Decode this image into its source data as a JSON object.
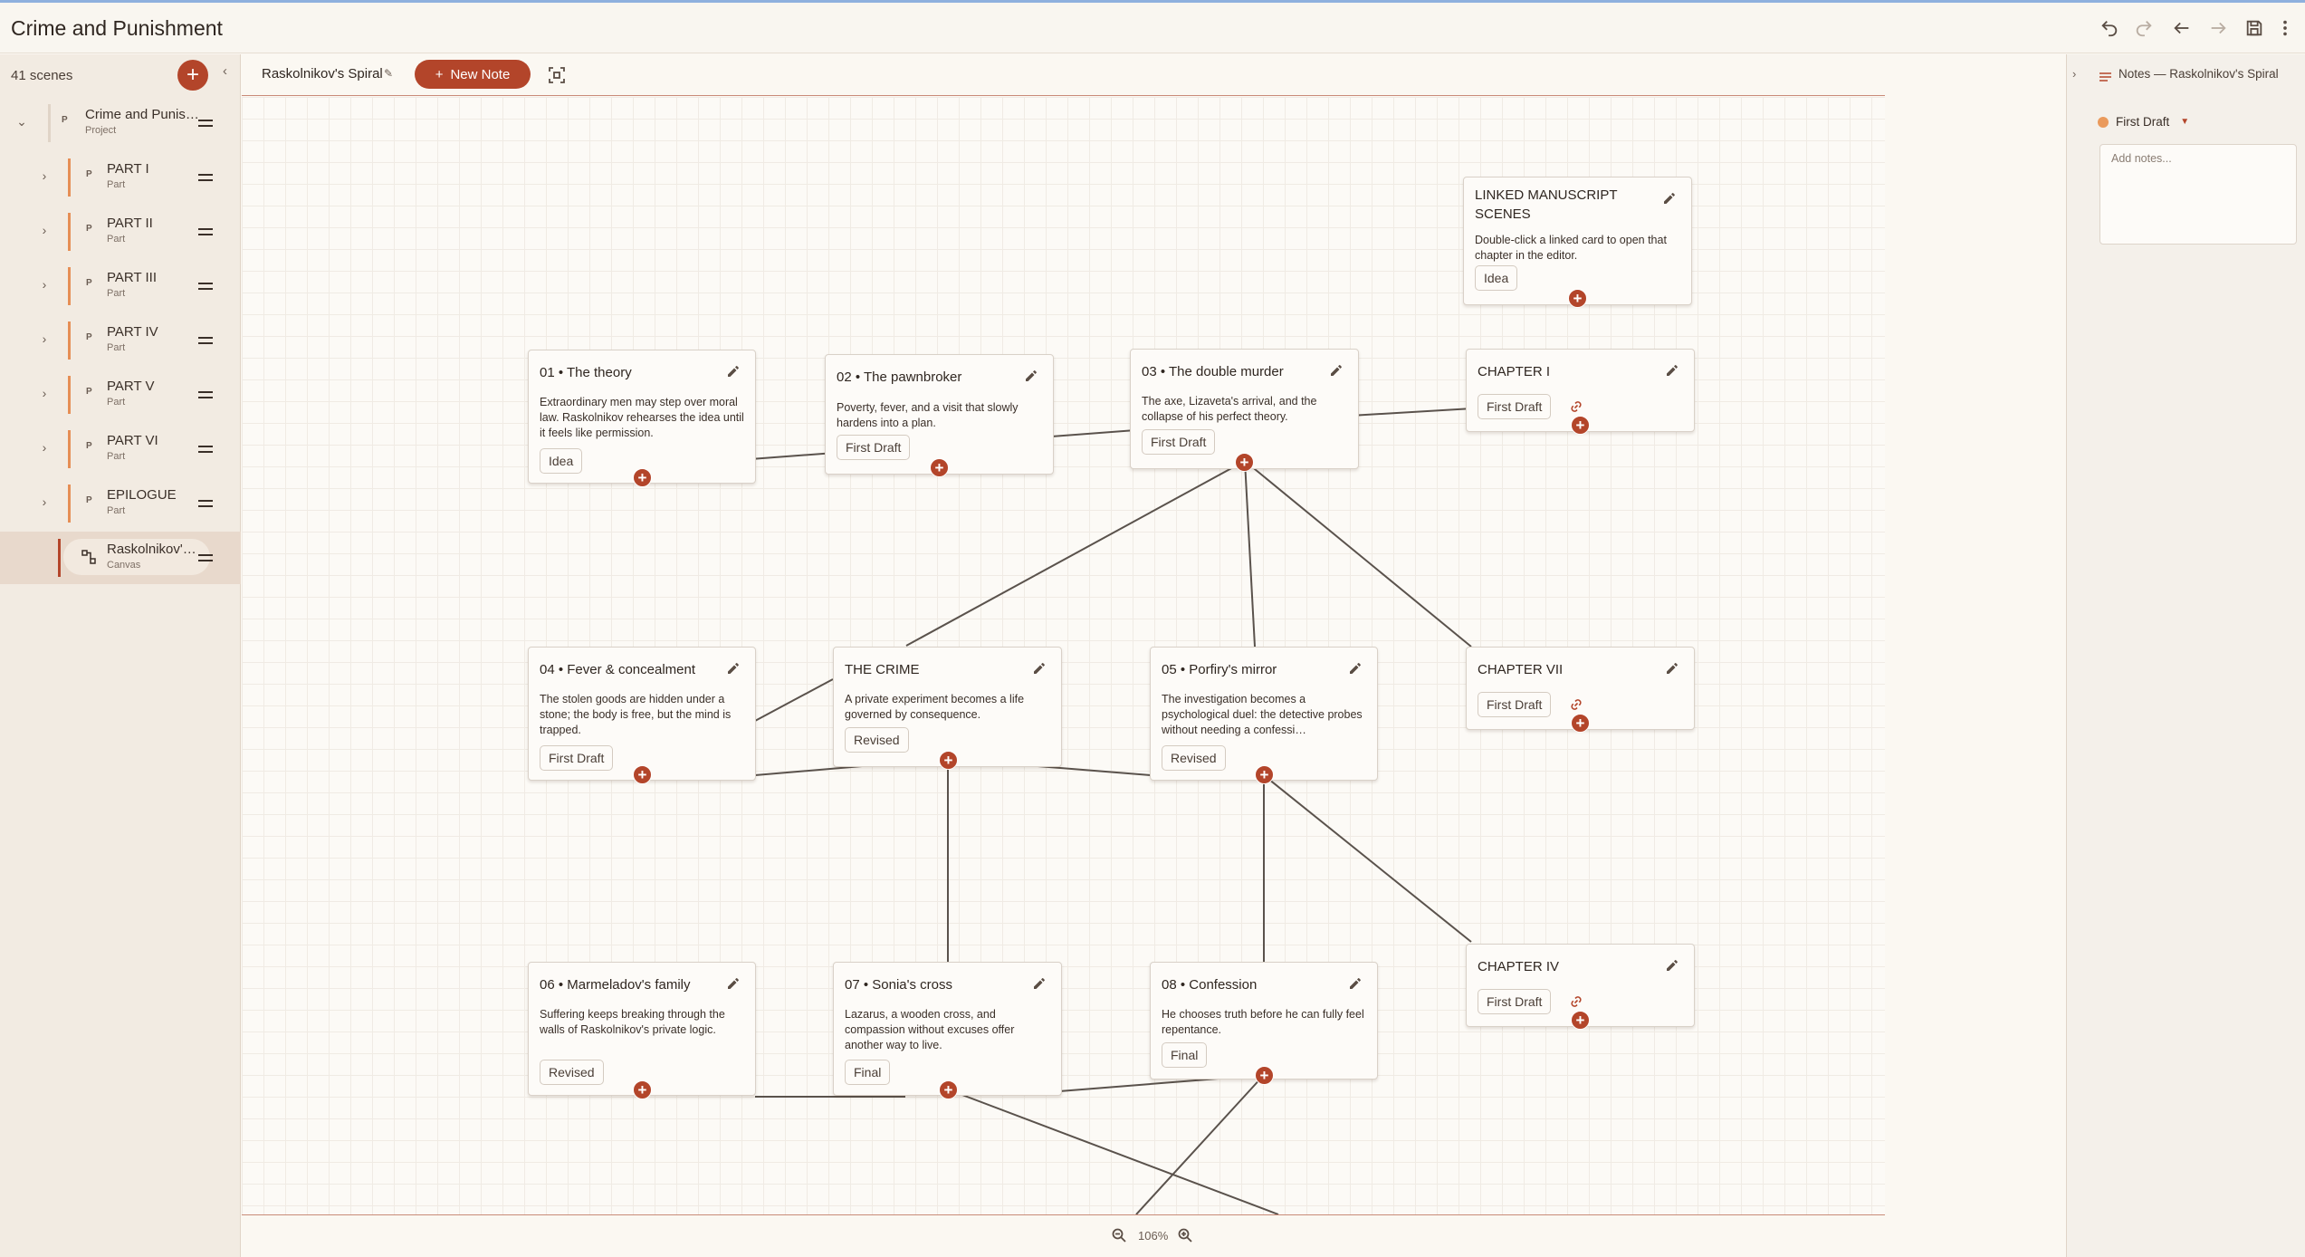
{
  "app": {
    "title": "Crime and Punishment"
  },
  "sidebar": {
    "scene_count": "41 scenes",
    "add_label": "+",
    "collapse_label": "‹",
    "items": [
      {
        "title": "Crime and Punishment",
        "subtitle": "Project",
        "badge": "P"
      },
      {
        "title": "PART I",
        "subtitle": "Part",
        "badge": "P"
      },
      {
        "title": "PART II",
        "subtitle": "Part",
        "badge": "P"
      },
      {
        "title": "PART III",
        "subtitle": "Part",
        "badge": "P"
      },
      {
        "title": "PART IV",
        "subtitle": "Part",
        "badge": "P"
      },
      {
        "title": "PART V",
        "subtitle": "Part",
        "badge": "P"
      },
      {
        "title": "PART VI",
        "subtitle": "Part",
        "badge": "P"
      },
      {
        "title": "EPILOGUE",
        "subtitle": "Part",
        "badge": "P"
      },
      {
        "title": "Raskolnikov's Spiral",
        "subtitle": "Canvas",
        "badge": "canvas-icon"
      }
    ]
  },
  "canvas": {
    "name": "Raskolnikov's Spiral",
    "new_note_label": "New Note",
    "zoom": "106%",
    "cards": [
      {
        "title": "LINKED MANUSCRIPT SCENES",
        "desc": "Double-click a linked card to open that chapter in the editor.",
        "status": "Idea"
      },
      {
        "title": "01  •  The theory",
        "desc": "Extraordinary men may step over moral law. Raskolnikov rehearses the idea until it feels like permission.",
        "status": "Idea"
      },
      {
        "title": "02  •  The pawnbroker",
        "desc": "Poverty, fever, and a visit that slowly hardens into a plan.",
        "status": "First Draft"
      },
      {
        "title": "03  •  The double murder",
        "desc": "The axe, Lizaveta's arrival, and the collapse of his perfect theory.",
        "status": "First Draft"
      },
      {
        "title": "CHAPTER I",
        "desc": "",
        "status": "First Draft"
      },
      {
        "title": "04  •  Fever & concealment",
        "desc": "The stolen goods are hidden under a stone; the body is free, but the mind is trapped.",
        "status": "First Draft"
      },
      {
        "title": "THE CRIME",
        "desc": "A private experiment becomes a life governed by consequence.",
        "status": "Revised"
      },
      {
        "title": "05  •  Porfiry's mirror",
        "desc": "The investigation becomes a psychological duel: the detective probes without needing a confessi…",
        "status": "Revised"
      },
      {
        "title": "CHAPTER VII",
        "desc": "",
        "status": "First Draft"
      },
      {
        "title": "06  •  Marmeladov's family",
        "desc": "Suffering keeps breaking through the walls of Raskolnikov's private logic.",
        "status": "Revised"
      },
      {
        "title": "07  •  Sonia's cross",
        "desc": "Lazarus, a wooden cross, and compassion without excuses offer another way to live.",
        "status": "Final"
      },
      {
        "title": "08  •  Confession",
        "desc": "He chooses truth before he can fully feel repentance.",
        "status": "Final"
      },
      {
        "title": "CHAPTER IV",
        "desc": "",
        "status": "First Draft"
      }
    ]
  },
  "notes_panel": {
    "title": "Notes — Raskolnikov's Spiral",
    "status": "First Draft",
    "placeholder": "Add notes..."
  },
  "colors": {
    "accent": "#b3452a",
    "status_dot": "#ea9a5c",
    "part_bar": "#e68e55"
  }
}
